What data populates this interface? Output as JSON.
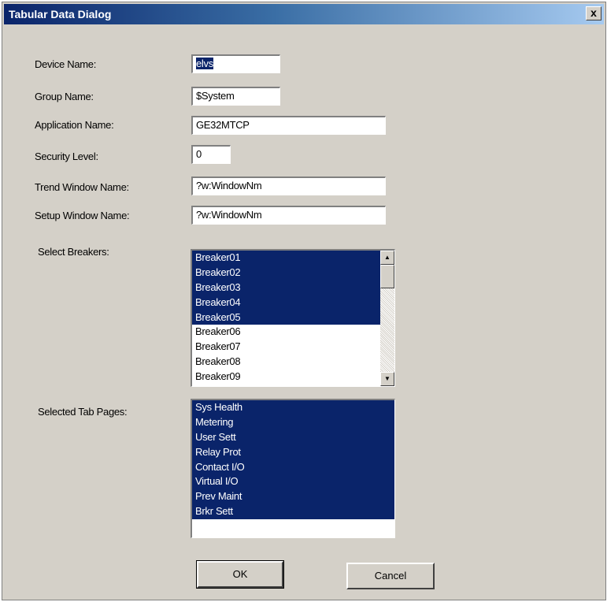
{
  "window": {
    "title": "Tabular Data Dialog",
    "close_glyph": "x"
  },
  "fields": {
    "device_name": {
      "label": "Device Name:",
      "value": "elvs"
    },
    "group_name": {
      "label": "Group Name:",
      "value": "$System"
    },
    "application_name": {
      "label": "Application Name:",
      "value": "GE32MTCP"
    },
    "security_level": {
      "label": "Security Level:",
      "value": "0"
    },
    "trend_window_name": {
      "label": "Trend Window Name:",
      "value": "?w:WindowNm"
    },
    "setup_window_name": {
      "label": "Setup Window Name:",
      "value": "?w:WindowNm"
    }
  },
  "breakers": {
    "label": "Select Breakers:",
    "items": [
      {
        "label": "Breaker01",
        "selected": true
      },
      {
        "label": "Breaker02",
        "selected": true
      },
      {
        "label": "Breaker03",
        "selected": true
      },
      {
        "label": "Breaker04",
        "selected": true
      },
      {
        "label": "Breaker05",
        "selected": true
      },
      {
        "label": "Breaker06",
        "selected": false
      },
      {
        "label": "Breaker07",
        "selected": false
      },
      {
        "label": "Breaker08",
        "selected": false
      },
      {
        "label": "Breaker09",
        "selected": false
      }
    ],
    "scroll_up_glyph": "▲",
    "scroll_down_glyph": "▼"
  },
  "tab_pages": {
    "label": "Selected Tab Pages:",
    "items": [
      {
        "label": "Sys Health",
        "selected": true
      },
      {
        "label": "Metering",
        "selected": true
      },
      {
        "label": "User Sett",
        "selected": true
      },
      {
        "label": "Relay Prot",
        "selected": true
      },
      {
        "label": "Contact I/O",
        "selected": true
      },
      {
        "label": "Virtual I/O",
        "selected": true
      },
      {
        "label": "Prev Maint",
        "selected": true
      },
      {
        "label": "Brkr Sett",
        "selected": true
      }
    ]
  },
  "buttons": {
    "ok_label": "OK",
    "cancel_label": "Cancel"
  },
  "colors": {
    "selection_bg": "#0a246a",
    "dialog_bg": "#d4d0c8",
    "title_gradient_start": "#0a246a"
  }
}
